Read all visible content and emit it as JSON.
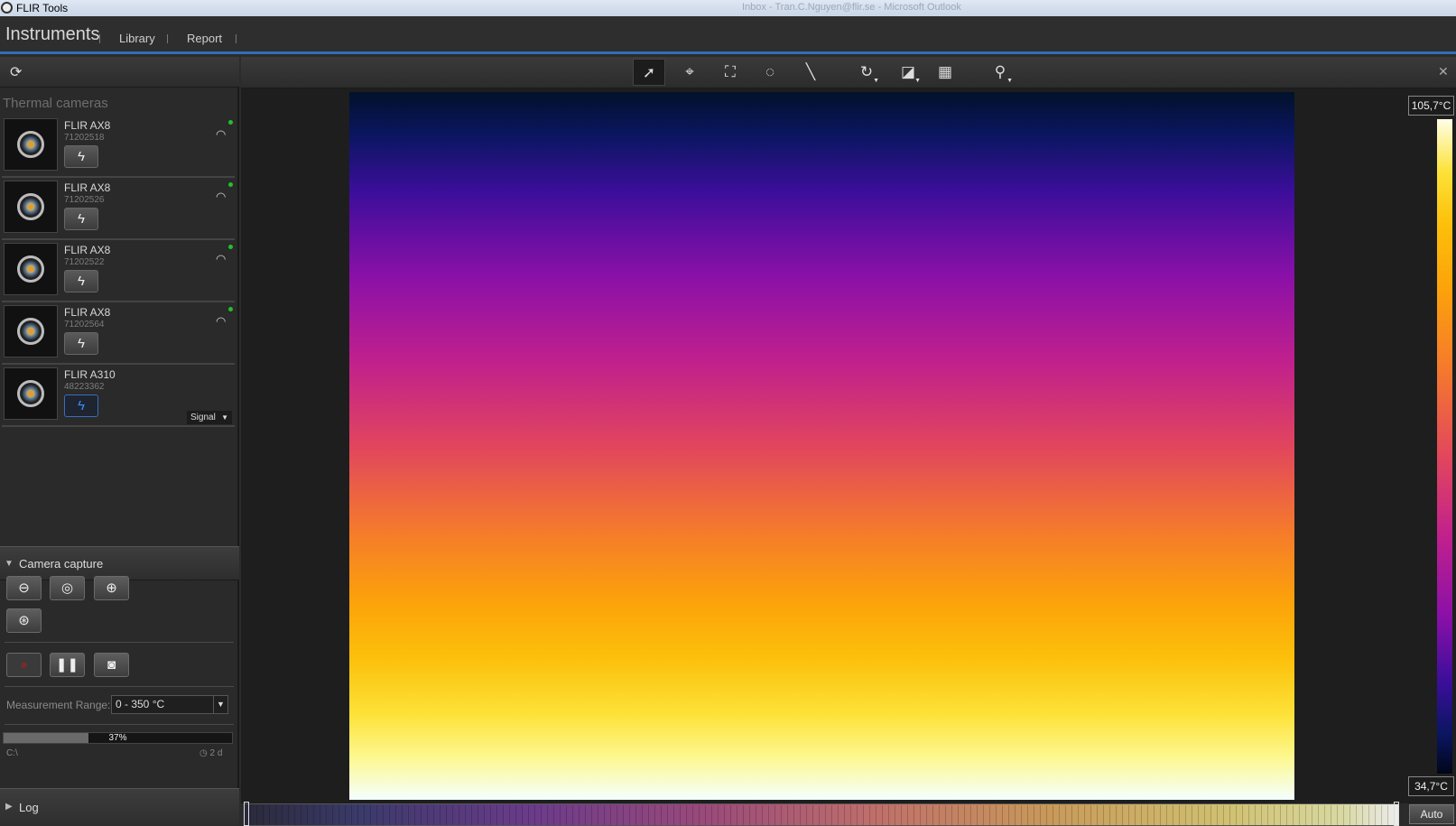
{
  "window": {
    "title": "FLIR Tools",
    "other_title": "Inbox - Tran.C.Nguyen@flir.se - Microsoft Outlook"
  },
  "menu": {
    "main": "Instruments",
    "items": [
      "Library",
      "Report"
    ]
  },
  "sidebar": {
    "section_title": "Thermal cameras",
    "cameras": [
      {
        "name": "FLIR AX8",
        "serial": "71202518",
        "connected": false,
        "wifi": true
      },
      {
        "name": "FLIR AX8",
        "serial": "71202526",
        "connected": false,
        "wifi": true
      },
      {
        "name": "FLIR AX8",
        "serial": "71202522",
        "connected": false,
        "wifi": true
      },
      {
        "name": "FLIR AX8",
        "serial": "71202564",
        "connected": false,
        "wifi": true
      },
      {
        "name": "FLIR A310",
        "serial": "48223362",
        "connected": true,
        "wifi": false,
        "signal_label": "Signal"
      }
    ],
    "capture": {
      "header": "Camera capture",
      "measurement_range_label": "Measurement Range:",
      "measurement_range_value": "0 - 350 °C",
      "progress_value": 37,
      "progress_text": "37%",
      "path": "C:\\",
      "age": "2 d"
    },
    "log": {
      "header": "Log"
    }
  },
  "toolbar": {
    "tools": [
      {
        "name": "select-tool",
        "icon": "arrow-cursor-icon",
        "glyph": "➚",
        "selected": true
      },
      {
        "name": "spot-tool",
        "icon": "crosshair-icon",
        "glyph": "⌖",
        "selected": false
      },
      {
        "name": "box-tool",
        "icon": "box-icon",
        "glyph": "⛶",
        "selected": false
      },
      {
        "name": "circle-tool",
        "icon": "circle-icon",
        "glyph": "◌",
        "selected": false
      },
      {
        "name": "line-tool",
        "icon": "line-icon",
        "glyph": "╲",
        "selected": false
      },
      {
        "name": "rotate-tool",
        "icon": "rotate-icon",
        "glyph": "↻",
        "selected": false,
        "dropdown": true
      },
      {
        "name": "palette-tool",
        "icon": "palette-icon",
        "glyph": "◪",
        "selected": false,
        "dropdown": true
      },
      {
        "name": "image-mode-tool",
        "icon": "image-mode-icon",
        "glyph": "▦",
        "selected": false
      },
      {
        "name": "search-tool",
        "icon": "search-icon",
        "glyph": "⚲",
        "selected": false,
        "dropdown": true
      }
    ],
    "close_glyph": "✕"
  },
  "scale": {
    "max": "105,7°C",
    "min": "34,7°C",
    "auto_label": "Auto"
  },
  "colors": {
    "accent": "#2f6fb8",
    "connected_dot": "#22c02a",
    "active_connect": "#3b8cff"
  }
}
